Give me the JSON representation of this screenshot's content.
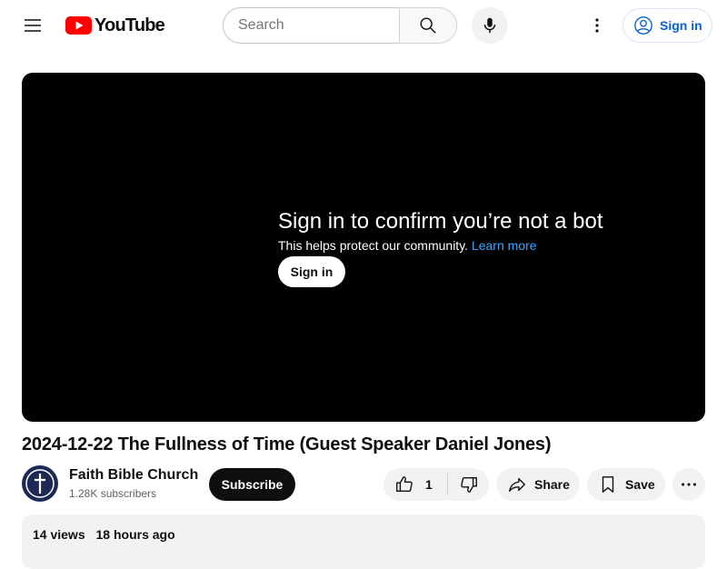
{
  "header": {
    "logo_text": "YouTube",
    "search_placeholder": "Search",
    "signin_label": "Sign in",
    "icons": [
      "menu-icon",
      "youtube-logo-icon",
      "search-icon",
      "mic-icon",
      "more-vert-icon",
      "account-icon"
    ]
  },
  "player": {
    "message_title": "Sign in to confirm you’re not a bot",
    "message_sub": "This helps protect our community.",
    "learn_more": "Learn more",
    "signin_label": "Sign in"
  },
  "video": {
    "title": "2024-12-22 The Fullness of Time (Guest Speaker Daniel Jones)",
    "channel_name": "Faith Bible Church",
    "subscribers": "1.28K subscribers",
    "subscribe_label": "Subscribe",
    "like_count": "1",
    "share_label": "Share",
    "save_label": "Save",
    "views": "14 views",
    "uploaded": "18 hours ago"
  },
  "colors": {
    "brand_red": "#ff0000",
    "link_blue": "#065fd4",
    "player_link": "#3ea6ff"
  }
}
